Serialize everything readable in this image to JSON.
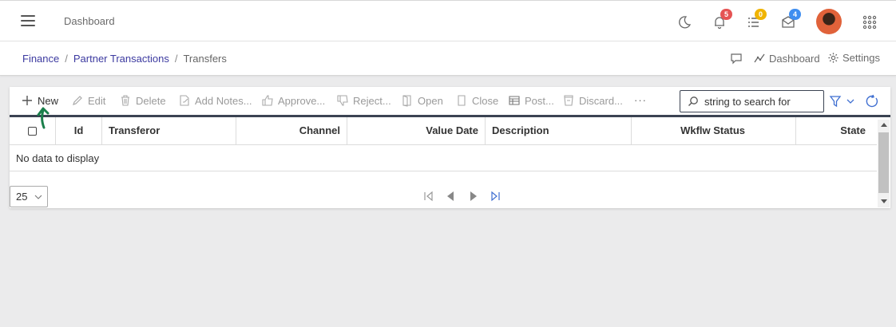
{
  "header": {
    "title": "Dashboard",
    "notifications_count": "5",
    "tasks_count": "0",
    "messages_count": "4",
    "colors": {
      "bell_badge": "#e55353",
      "tasks_badge": "#f0b400",
      "messages_badge": "#3f8ef0"
    }
  },
  "breadcrumb": {
    "items": [
      "Finance",
      "Partner Transactions"
    ],
    "current": "Transfers",
    "dashboard_label": "Dashboard",
    "settings_label": "Settings"
  },
  "toolbar": {
    "new": "New",
    "edit": "Edit",
    "delete": "Delete",
    "add_notes": "Add Notes...",
    "approve": "Approve...",
    "reject": "Reject...",
    "open": "Open",
    "close": "Close",
    "post": "Post...",
    "discard": "Discard...",
    "more": "···",
    "search_placeholder": "string to search for"
  },
  "grid": {
    "columns": [
      "Id",
      "Transferor",
      "Channel",
      "Value Date",
      "Description",
      "Wkflw Status",
      "State"
    ],
    "empty_text": "No data to display",
    "page_size": "25"
  },
  "colors": {
    "accent": "#3c3aa0",
    "toolbar_border": "#3b4352",
    "annotation": "#1a7f4b"
  }
}
